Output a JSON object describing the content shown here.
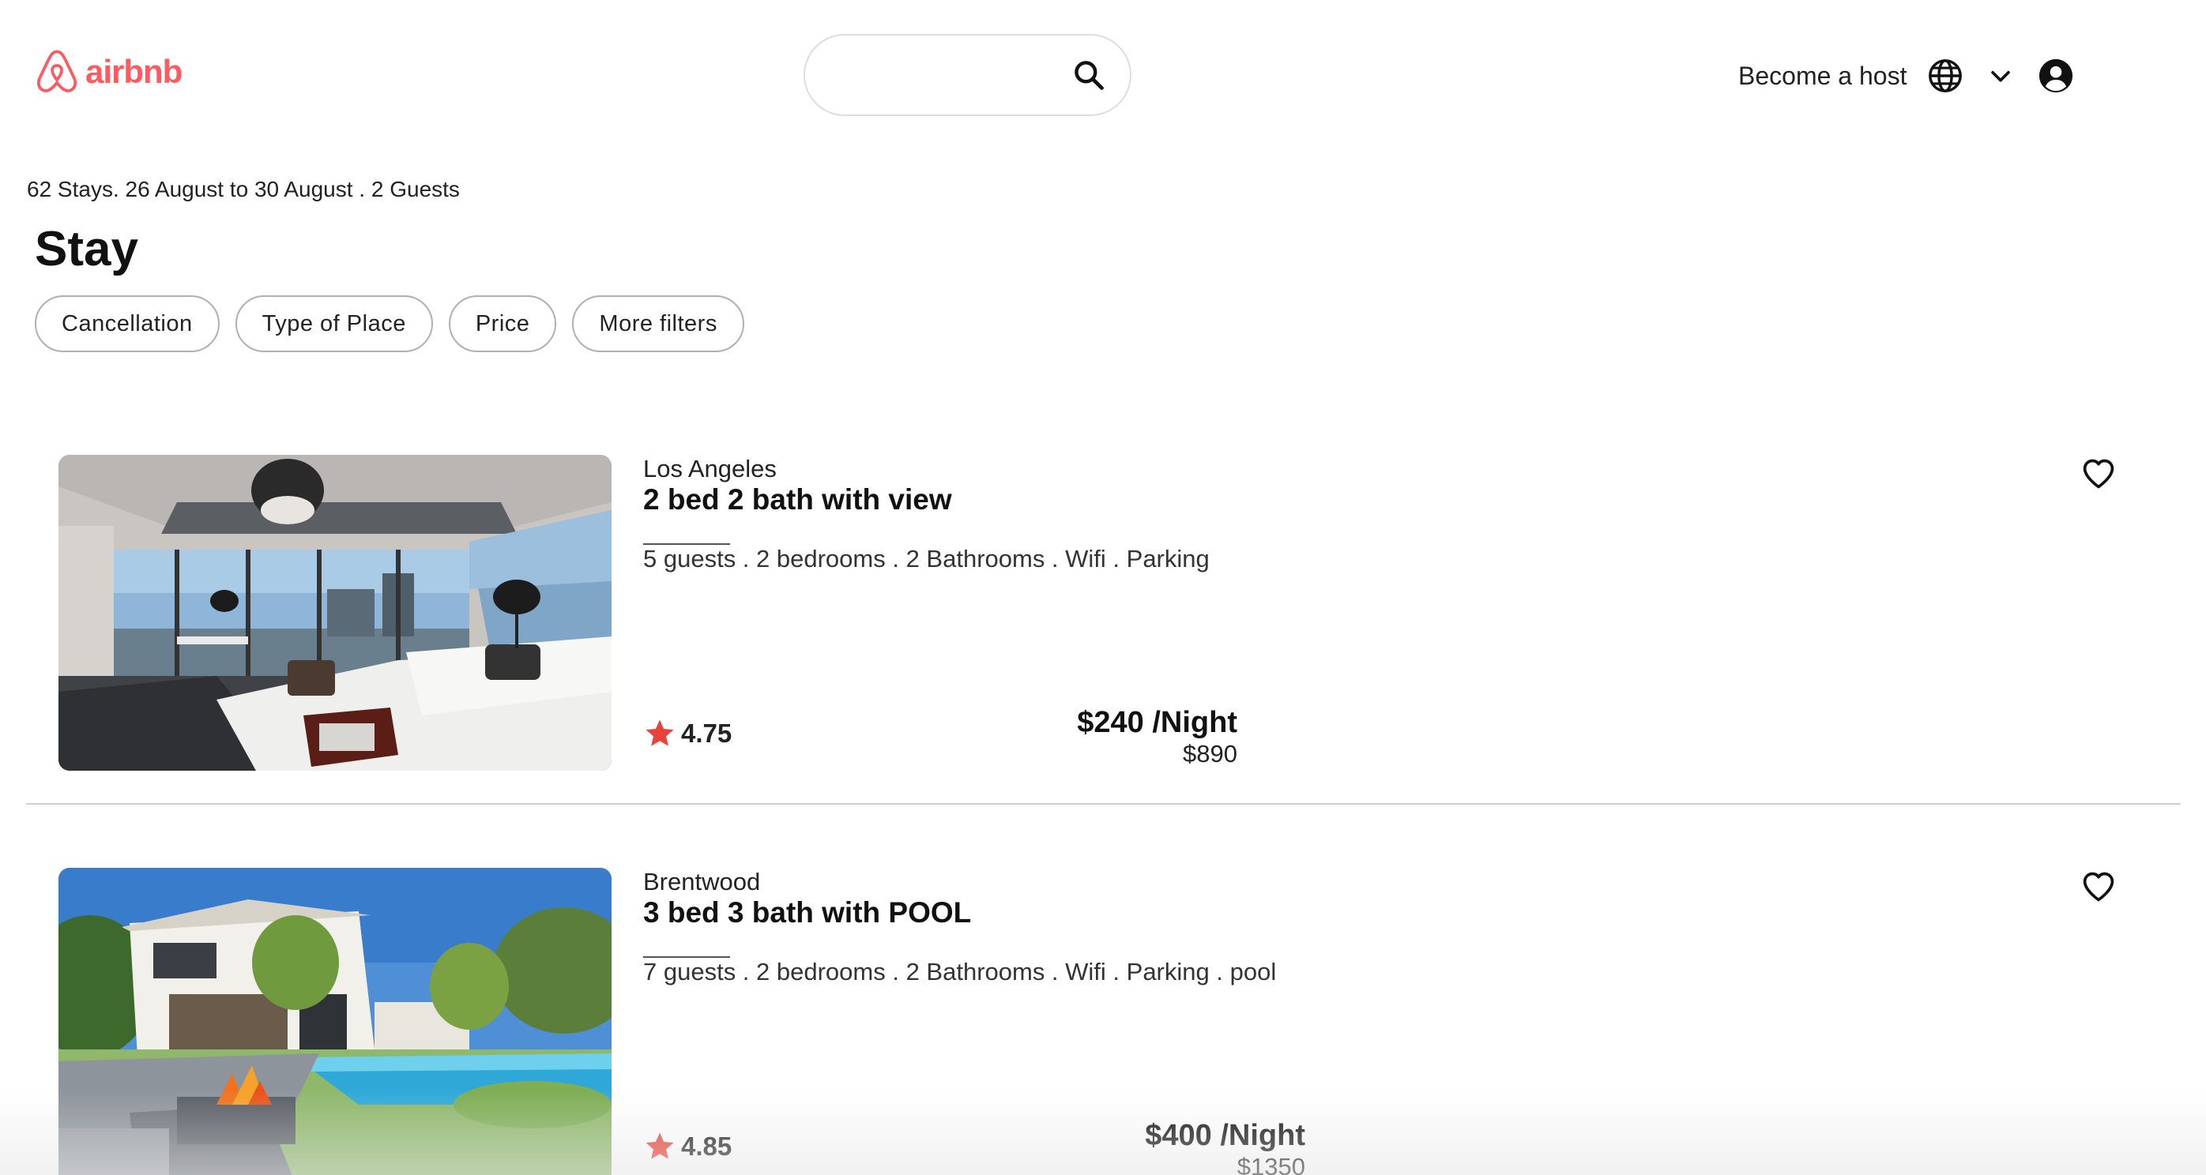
{
  "brand": {
    "name": "airbnb",
    "color": "#FF5A5F"
  },
  "search": {
    "value": "",
    "placeholder": "",
    "icon": "search-icon"
  },
  "nav": {
    "become_host": "Become a host",
    "icons": [
      "globe-icon",
      "chevron-down-icon",
      "account-icon"
    ]
  },
  "summary": "62 Stays. 26 August to 30 August . 2 Guests",
  "page_title": "Stay",
  "filters": [
    "Cancellation",
    "Type of Place",
    "Price",
    "More filters"
  ],
  "listings": [
    {
      "location": "Los Angeles",
      "title": "2 bed 2 bath with view",
      "amenities": "5 guests . 2 bedrooms . 2 Bathrooms . Wifi . Parking",
      "rating": "4.75",
      "price": "$240 /Night",
      "total": "$890",
      "favorite": false
    },
    {
      "location": "Brentwood",
      "title": "3 bed 3 bath with POOL",
      "amenities": "7 guests . 2 bedrooms . 2 Bathrooms . Wifi . Parking . pool",
      "rating": "4.85",
      "price": "$400 /Night",
      "total": "$1350",
      "favorite": false
    }
  ],
  "colors": {
    "star": "#E8433A",
    "text": "#222222",
    "divider": "#d0d0d0"
  }
}
